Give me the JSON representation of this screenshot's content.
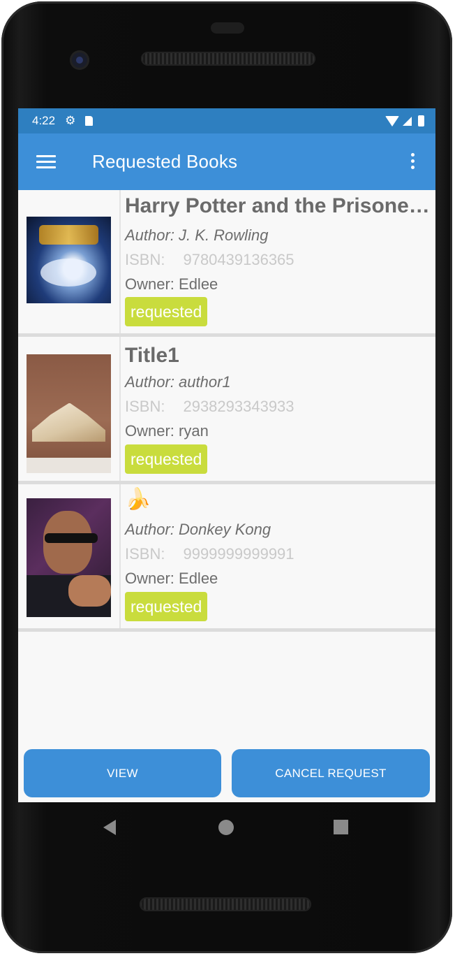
{
  "status_bar": {
    "time": "4:22"
  },
  "app_bar": {
    "title": "Requested Books"
  },
  "books": [
    {
      "title": "Harry Potter and the Prisoner of Azkaban",
      "author": "Author: J. K. Rowling",
      "isbn_label": "ISBN:",
      "isbn": "9780439136365",
      "owner": "Owner: Edlee",
      "status": "requested"
    },
    {
      "title": "Title1",
      "author": "Author: author1",
      "isbn_label": "ISBN:",
      "isbn": "2938293343933",
      "owner": "Owner: ryan",
      "status": "requested"
    },
    {
      "title": "🍌",
      "author": "Author: Donkey Kong",
      "isbn_label": "ISBN:",
      "isbn": "9999999999991",
      "owner": "Owner: Edlee",
      "status": "requested"
    }
  ],
  "buttons": {
    "view": "VIEW",
    "cancel": "CANCEL REQUEST"
  },
  "colors": {
    "status_bar": "#2e7fc0",
    "app_bar": "#3d8fd8",
    "badge": "#c9dc3d",
    "button": "#3d8fd8"
  }
}
